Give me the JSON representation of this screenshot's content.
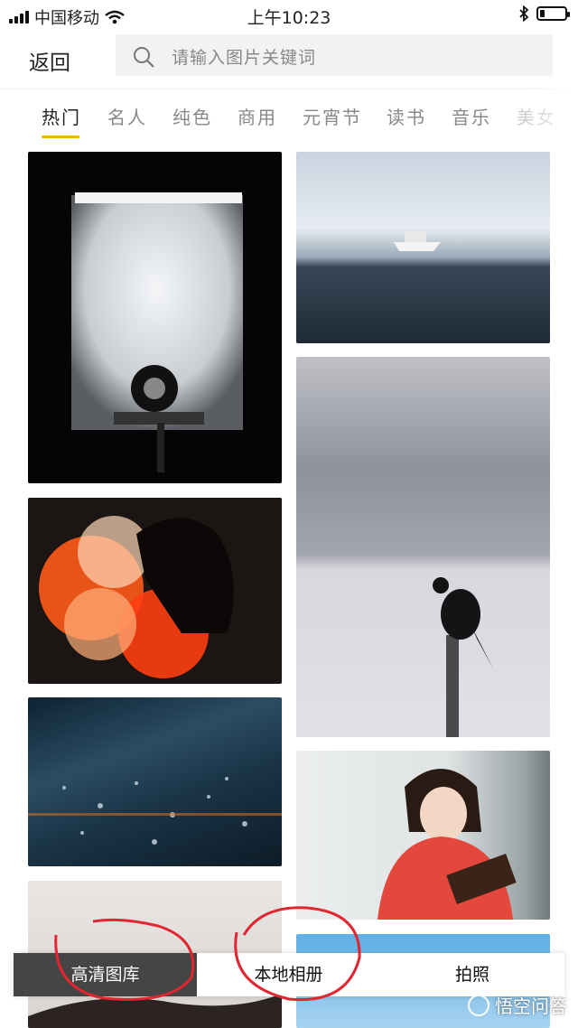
{
  "status_bar": {
    "carrier": "中国移动",
    "time": "上午10:23",
    "signal_bars": 4,
    "battery_level_pct": 20
  },
  "header": {
    "back_label": "返回",
    "search_placeholder": "请输入图片关键词"
  },
  "tabs": [
    {
      "label": "热门",
      "active": true
    },
    {
      "label": "名人"
    },
    {
      "label": "纯色"
    },
    {
      "label": "商用"
    },
    {
      "label": "元宵节"
    },
    {
      "label": "读书"
    },
    {
      "label": "音乐"
    },
    {
      "label": "美女"
    }
  ],
  "photos": [
    "trailer-spare-tire",
    "yacht-on-sea",
    "crow-in-snow",
    "silhouette-bokeh",
    "water-droplets",
    "girl-reading-book",
    "woman-lying",
    "blue-sky"
  ],
  "action_bar": {
    "items": [
      {
        "label": "高清图库",
        "selected": true
      },
      {
        "label": "本地相册"
      },
      {
        "label": "拍照"
      }
    ]
  },
  "watermark": "悟空问答",
  "colors": {
    "accent": "#f0b400",
    "annotation_red": "#e0262f",
    "selected_action_bg": "#454545"
  }
}
